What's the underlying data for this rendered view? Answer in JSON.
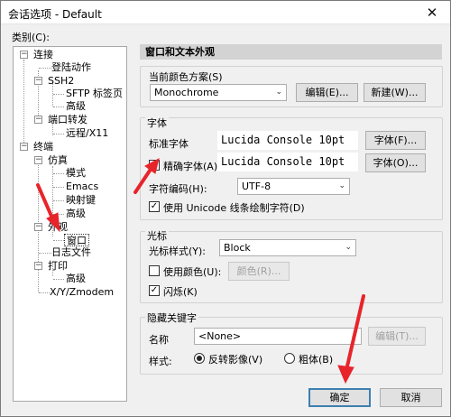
{
  "window": {
    "title": "会话选项 - Default",
    "close_label": "✕"
  },
  "category_label": "类别(C):",
  "tree": {
    "connect": "连接",
    "login_actions": "登陆动作",
    "ssh2": "SSH2",
    "sftp_tab": "SFTP 标签页",
    "advanced1": "高级",
    "port_forward": "端口转发",
    "remote_x11": "远程/X11",
    "terminal": "终端",
    "emulation": "仿真",
    "modes": "模式",
    "emacs": "Emacs",
    "key_map": "映射键",
    "advanced2": "高级",
    "appearance": "外观",
    "window_item": "窗口",
    "log_file": "日志文件",
    "print": "打印",
    "advanced3": "高级",
    "xyz": "X/Y/Zmodem"
  },
  "panel": {
    "header": "窗口和文本外观",
    "scheme": {
      "group_label": "当前颜色方案(S)",
      "value": "Monochrome",
      "edit": "编辑(E)...",
      "new": "新建(W)..."
    },
    "font": {
      "group_label": "字体",
      "normal_label": "标准字体",
      "normal_value": "Lucida Console 10pt",
      "normal_btn": "字体(F)...",
      "precise_label": "精确字体(A):",
      "precise_value": "Lucida Console 10pt",
      "precise_btn": "字体(O)...",
      "encoding_label": "字符编码(H):",
      "encoding_value": "UTF-8",
      "unicode_label": "使用 Unicode 线条绘制字符(D)"
    },
    "cursor": {
      "group_label": "光标",
      "style_label": "光标样式(Y):",
      "style_value": "Block",
      "use_color_label": "使用颜色(U):",
      "color_btn": "颜色(R)...",
      "blink_label": "闪烁(K)"
    },
    "keyword": {
      "group_label": "隐藏关键字",
      "name_label": "名称",
      "name_value": "<None>",
      "edit_btn": "编辑(T)...",
      "style_label": "样式:",
      "reverse_label": "反转影像(V)",
      "bold_label": "粗体(B)"
    }
  },
  "footer": {
    "ok": "确定",
    "cancel": "取消"
  },
  "checkmark": "✓",
  "colors": {
    "annotation_arrow": "#e8242b",
    "default_button_border": "#3c7fb1"
  }
}
